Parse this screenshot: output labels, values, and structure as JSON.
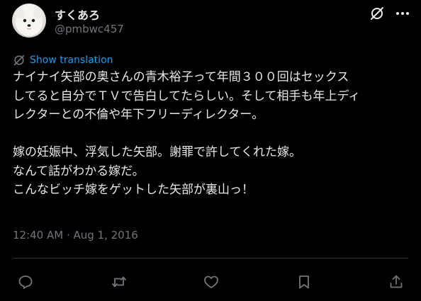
{
  "author": {
    "display_name": "すくあろ",
    "handle": "@pmbwc457",
    "avatar_icon": "white-pomeranian-dog-avatar"
  },
  "header_icons": [
    "grok-slash-icon",
    "more-options-icon"
  ],
  "translation": {
    "icon": "grok-slash-icon",
    "label": "Show translation"
  },
  "tweet": {
    "lines": [
      "ナイナイ矢部の奥さんの青木裕子って年間３００回はセックス",
      "してると自分でＴＶで告白してたらしい。そして相手も年上ディ",
      "レクターとの不倫や年下フリーディレクター。",
      "",
      "嫁の妊娠中、浮気した矢部。謝罪で許してくれた嫁。",
      "なんて話がわかる嫁だ。",
      "こんなビッチ嫁をゲットした矢部が裏山っ！"
    ],
    "timestamp": "12:40 AM · Aug 1, 2016"
  },
  "actions": [
    {
      "name": "reply-button",
      "icon": "reply-icon"
    },
    {
      "name": "retweet-button",
      "icon": "retweet-icon"
    },
    {
      "name": "like-button",
      "icon": "like-icon"
    },
    {
      "name": "bookmark-button",
      "icon": "bookmark-icon"
    },
    {
      "name": "share-button",
      "icon": "share-icon"
    }
  ],
  "colors": {
    "background": "#000000",
    "text": "#e7e9ea",
    "secondary": "#71767b",
    "link": "#1d9bf0",
    "divider": "#2f3336"
  }
}
